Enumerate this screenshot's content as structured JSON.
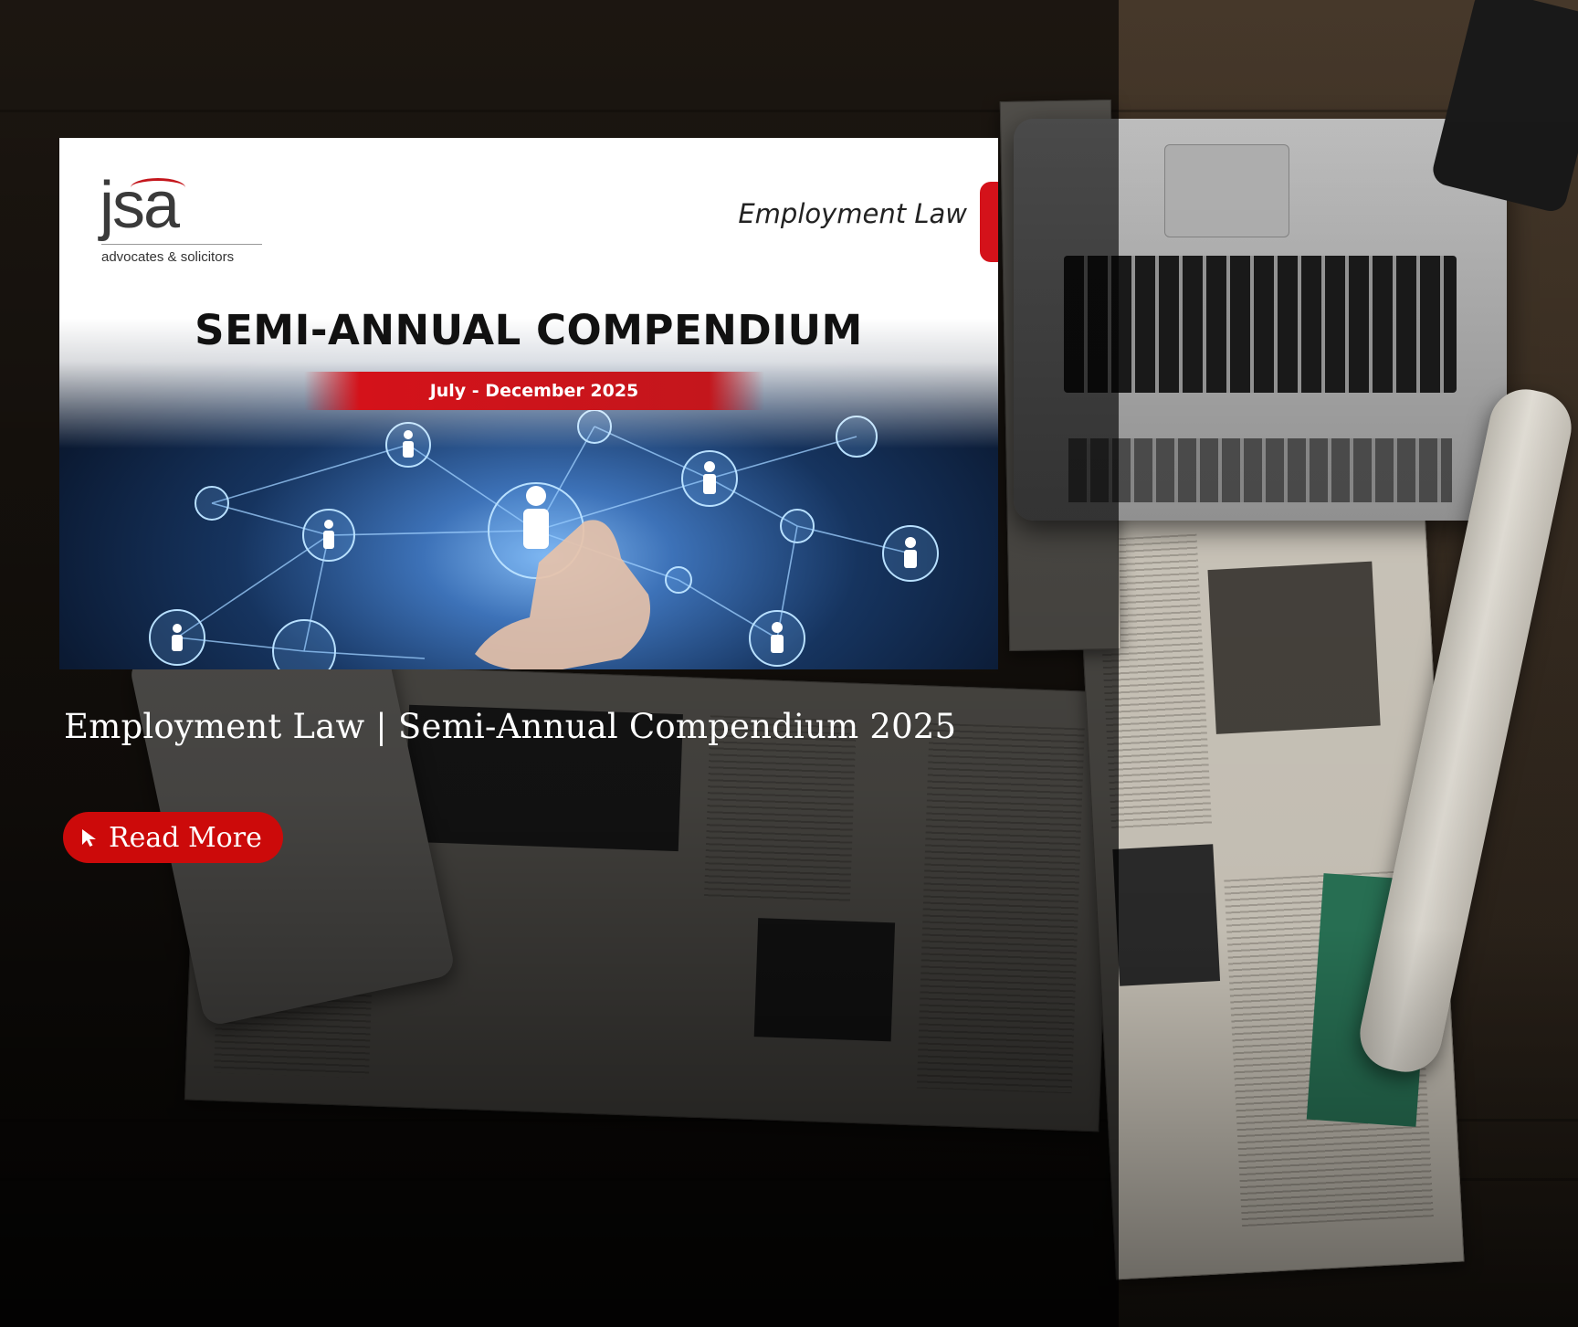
{
  "post": {
    "title": "Employment Law | Semi-Annual Compendium 2025",
    "read_more_label": "Read More",
    "read_more_icon": "cursor-arrow-icon"
  },
  "banner": {
    "logo_mark": "jsa",
    "logo_tagline": "advocates & solicitors",
    "practice_area": "Employment Law",
    "headline": "SEMI-ANNUAL COMPENDIUM",
    "period": "July - December 2025"
  },
  "colors": {
    "accent_red": "#cc0a0a",
    "banner_red": "#d4121a",
    "title_text": "#ffffff"
  }
}
